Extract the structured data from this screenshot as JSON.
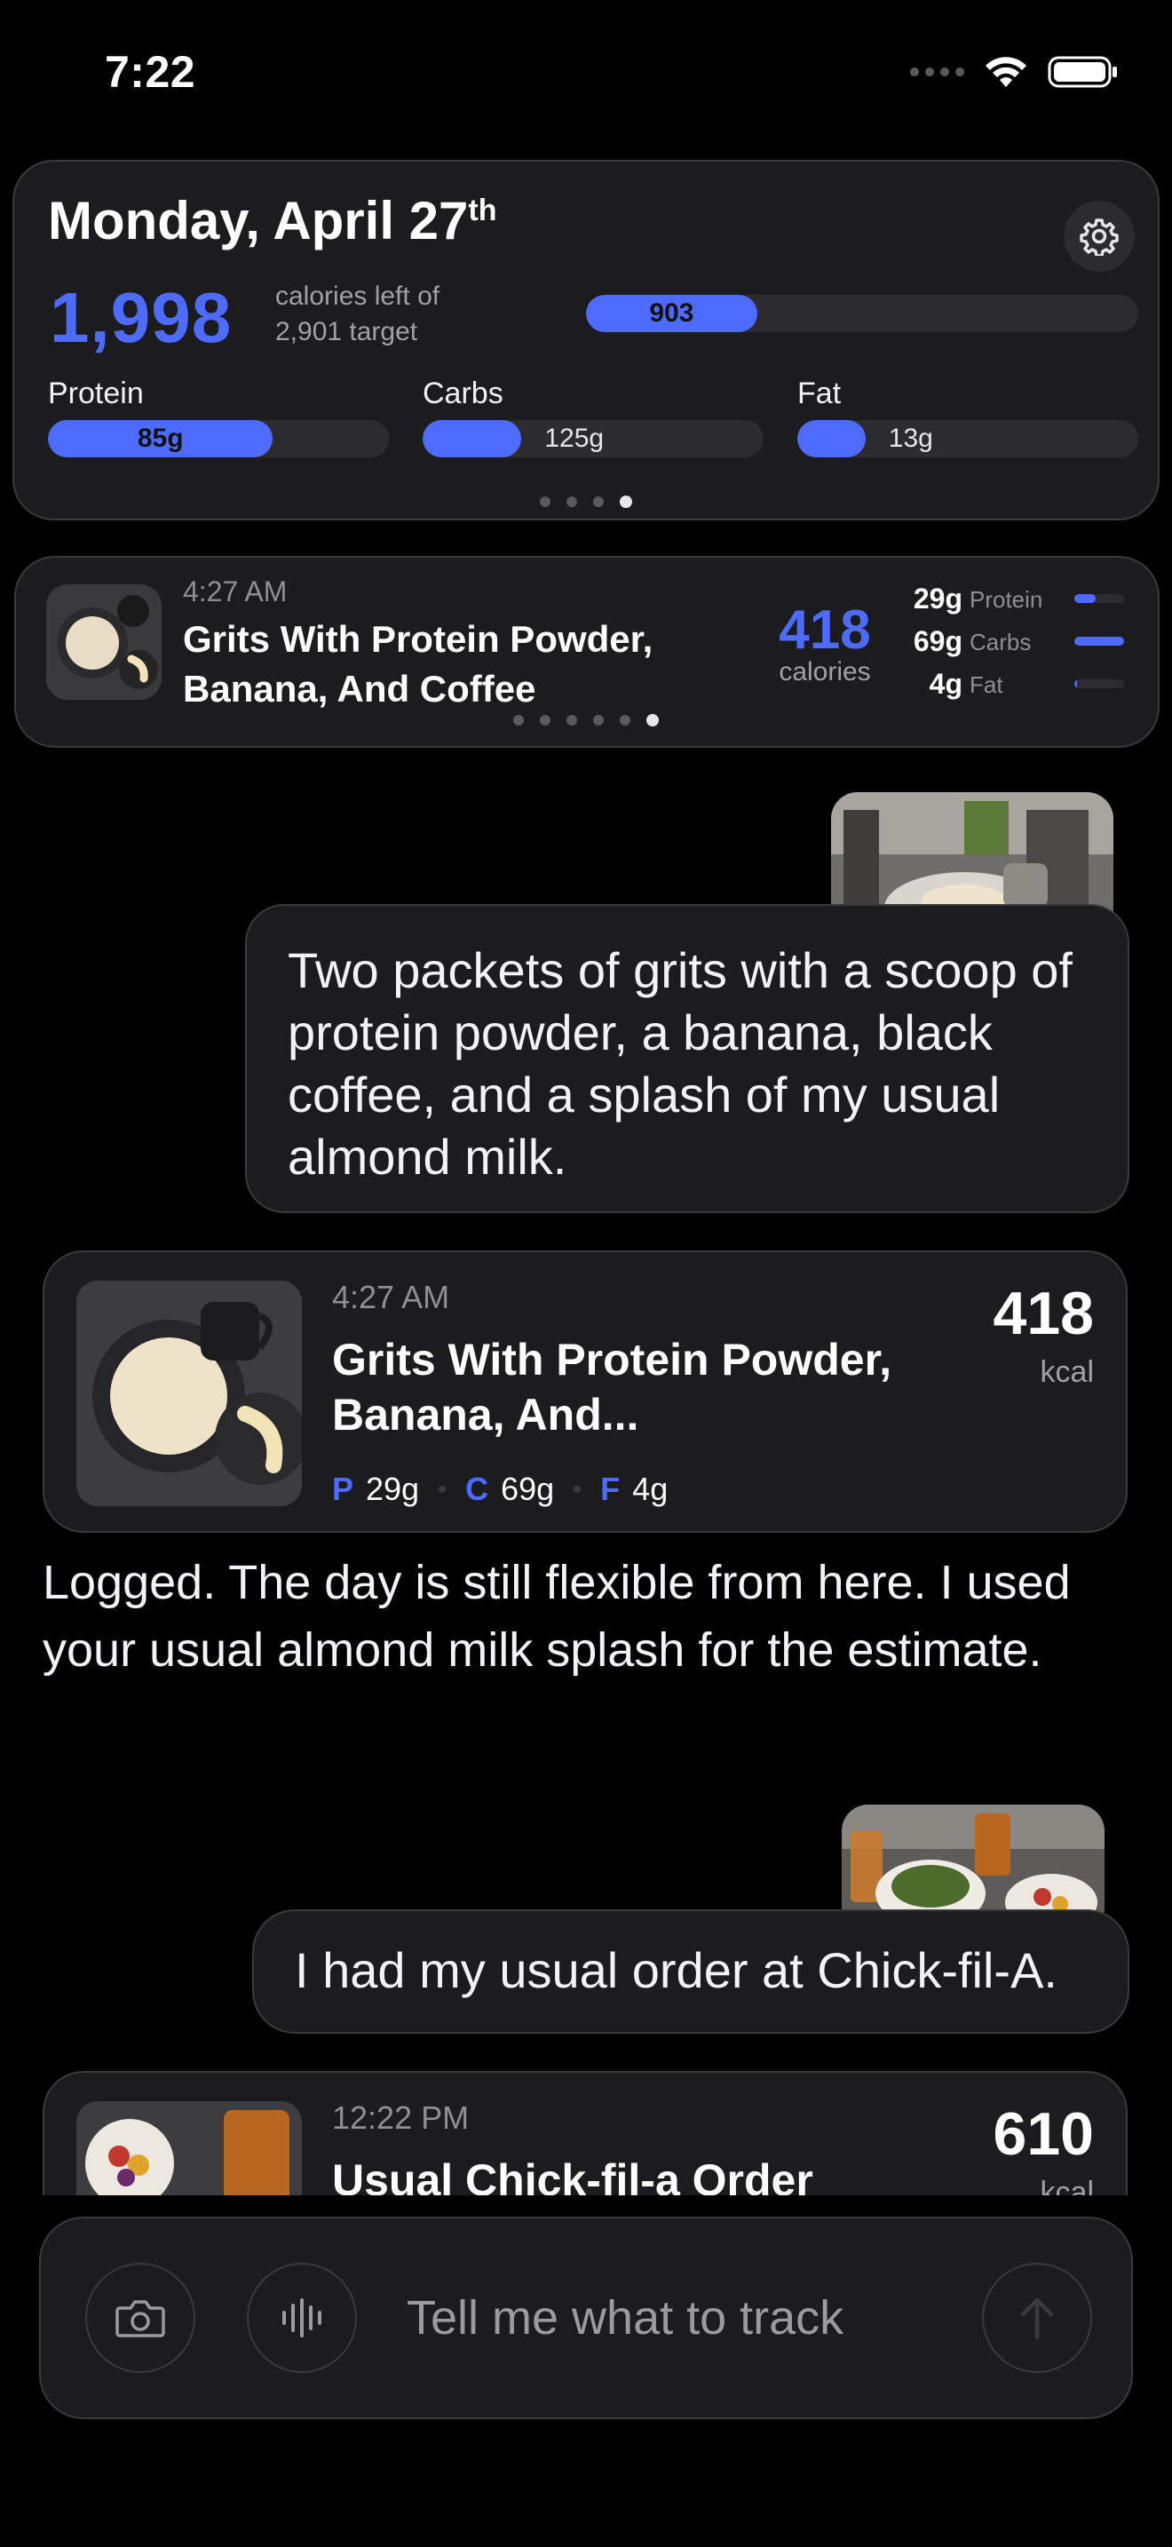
{
  "status_bar": {
    "time": "7:22"
  },
  "summary": {
    "day_title": "Monday, April 27",
    "day_suffix": "th",
    "calories_left": "1,998",
    "calories_note_line1": "calories left of",
    "calories_note_line2": "2,901 target",
    "calories_eaten": "903",
    "calories_eaten_fraction": 0.31,
    "macros": [
      {
        "label": "Protein",
        "value": "85g",
        "fraction": 0.66
      },
      {
        "label": "Carbs",
        "value": "125g",
        "fraction": 0.29
      },
      {
        "label": "Fat",
        "value": "13g",
        "fraction": 0.2
      }
    ],
    "pages": {
      "count": 4,
      "active": 4
    }
  },
  "meal_strip": {
    "time": "4:27 AM",
    "name": "Grits With Protein Powder, Banana, And Coffee",
    "calories": "418",
    "calories_label": "calories",
    "macros": [
      {
        "value": "29g",
        "name": "Protein",
        "fraction": 0.42
      },
      {
        "value": "69g",
        "name": "Carbs",
        "fraction": 1.0
      },
      {
        "value": "4g",
        "name": "Fat",
        "fraction": 0.06
      }
    ],
    "pages": {
      "count": 6,
      "active": 6
    }
  },
  "chat": {
    "user_message_1": "Two packets of grits with a scoop of protein powder, a banana, black coffee, and a splash of my usual almond milk.",
    "entry_1": {
      "time": "4:27 AM",
      "name": "Grits With Protein Powder, Banana, And...",
      "kcal": "418",
      "unit": "kcal",
      "protein_key": "P",
      "protein": "29g",
      "carbs_key": "C",
      "carbs": "69g",
      "fat_key": "F",
      "fat": "4g"
    },
    "assistant_message_1": "Logged. The day is still flexible from here. I used your usual almond milk splash for the estimate.",
    "user_message_2": "I had my usual order at Chick-fil-A.",
    "entry_2": {
      "time": "12:22 PM",
      "name": "Usual Chick-fil-a Order",
      "kcal": "610",
      "unit": "kcal"
    }
  },
  "composer": {
    "placeholder": "Tell me what to track"
  },
  "colors": {
    "accent": "#4d6cff",
    "card": "#1c1c1e",
    "border": "#3a3a3c"
  }
}
